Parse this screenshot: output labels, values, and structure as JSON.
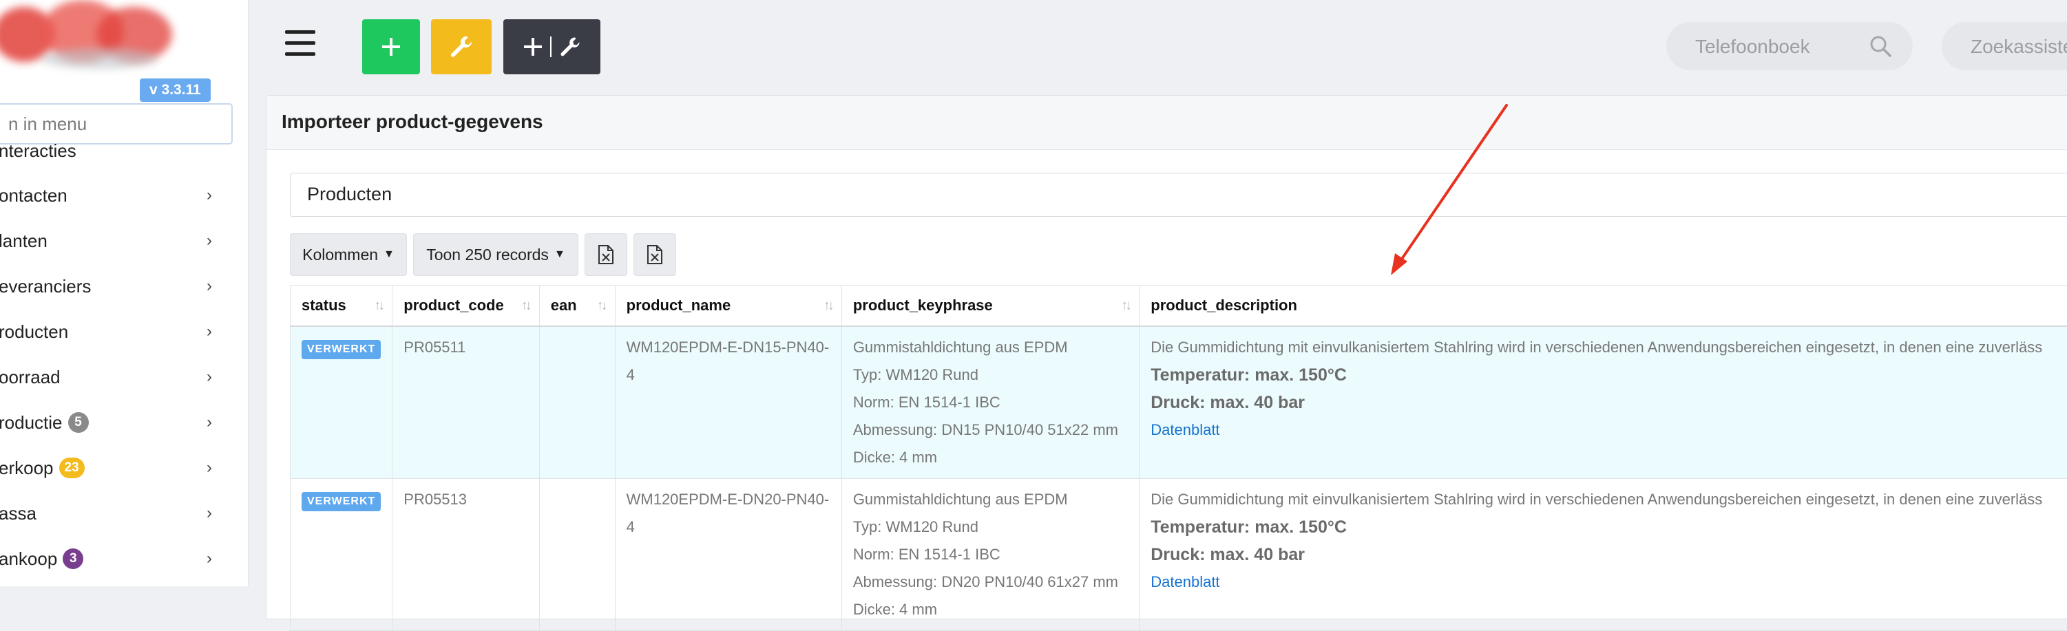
{
  "sidebar": {
    "version": "v 3.3.11",
    "search_placeholder": "n in menu",
    "items": [
      {
        "label": "nteracties"
      },
      {
        "label": "ontacten"
      },
      {
        "label": "lanten"
      },
      {
        "label": "everanciers"
      },
      {
        "label": "roducten"
      },
      {
        "label": "oorraad"
      },
      {
        "label": "roductie",
        "badge": "5",
        "badge_color": "#8a8a8a"
      },
      {
        "label": "erkoop",
        "badge": "23",
        "badge_color": "#f3bb1c"
      },
      {
        "label": "assa"
      },
      {
        "label": "ankoop",
        "badge": "3",
        "badge_color": "#7a3e8e"
      }
    ]
  },
  "topbar": {
    "add_label": "+",
    "dark_label": "+ | ",
    "phone_search_placeholder": "Telefoonboek",
    "cash_search_placeholder": "Zoekassiste"
  },
  "panel": {
    "title": "Importeer product-gegevens",
    "products_label": "Producten",
    "columns_button": "Kolommen",
    "records_button": "Toon 250 records"
  },
  "table": {
    "headers": [
      "status",
      "product_code",
      "ean",
      "product_name",
      "product_keyphrase",
      "product_description"
    ],
    "rows": [
      {
        "status": "VERWERKT",
        "product_code": "PR05511",
        "ean": "",
        "product_name": "WM120EPDM-E-DN15-PN40-4",
        "keyphrase": [
          "Gummistahldichtung aus EPDM",
          "Typ: WM120 Rund",
          "Norm: EN 1514-1 IBC",
          "Abmessung: DN15 PN10/40 51x22 mm",
          "Dicke: 4 mm"
        ],
        "description": "Die Gummidichtung mit einvulkanisiertem Stahlring wird in verschiedenen Anwendungsbereichen eingesetzt, in denen eine zuverläss",
        "temp": "Temperatur: max. 150°C",
        "pressure": "Druck: max. 40 bar",
        "link": "Datenblatt"
      },
      {
        "status": "VERWERKT",
        "product_code": "PR05513",
        "ean": "",
        "product_name": "WM120EPDM-E-DN20-PN40-4",
        "keyphrase": [
          "Gummistahldichtung aus EPDM",
          "Typ: WM120 Rund",
          "Norm: EN 1514-1 IBC",
          "Abmessung: DN20 PN10/40 61x27 mm",
          "Dicke: 4 mm"
        ],
        "description": "Die Gummidichtung mit einvulkanisiertem Stahlring wird in verschiedenen Anwendungsbereichen eingesetzt, in denen eine zuverläss",
        "temp": "Temperatur: max. 150°C",
        "pressure": "Druck: max. 40 bar",
        "link": "Datenblatt"
      }
    ]
  },
  "colors": {
    "accent_green": "#1ec85e",
    "accent_yellow": "#f3bb1c",
    "dark_button": "#3a3d45",
    "status_blue": "#5ea8ee",
    "link_blue": "#1673d0",
    "annotation_red": "#e8321f"
  }
}
